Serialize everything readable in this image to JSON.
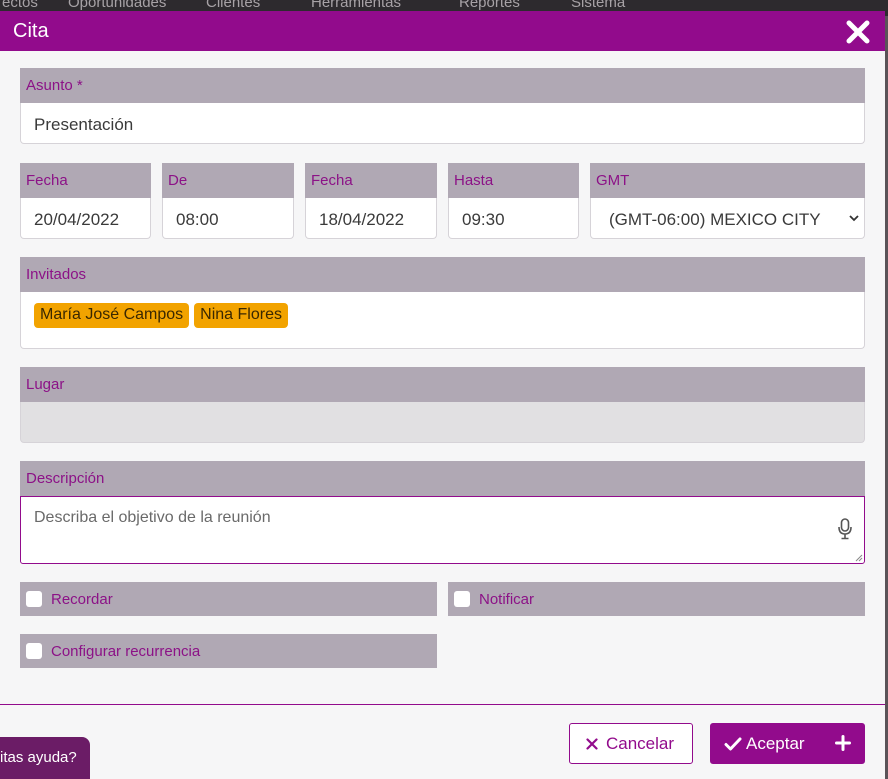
{
  "background": {
    "nav_items": [
      "ectos",
      "Oportunidades",
      "Clientes",
      "Herramientas",
      "Reportes",
      "Sistema"
    ],
    "help_label": "itas ayuda?"
  },
  "modal": {
    "title": "Cita",
    "subject": {
      "label": "Asunto *",
      "value": "Presentación"
    },
    "start_date": {
      "label": "Fecha",
      "value": "20/04/2022"
    },
    "start_time": {
      "label": "De",
      "value": "08:00"
    },
    "end_date": {
      "label": "Fecha",
      "value": "18/04/2022"
    },
    "end_time": {
      "label": "Hasta",
      "value": "09:30"
    },
    "timezone": {
      "label": "GMT",
      "value": "(GMT-06:00) MEXICO CITY"
    },
    "guests": {
      "label": "Invitados",
      "tags": [
        "María José Campos",
        "Nina Flores"
      ]
    },
    "place": {
      "label": "Lugar",
      "value": ""
    },
    "description": {
      "label": "Descripción",
      "placeholder": "Describa el objetivo de la reunión"
    },
    "options": {
      "remind": "Recordar",
      "notify": "Notificar",
      "recurrence": "Configurar recurrencia"
    },
    "buttons": {
      "cancel": "Cancelar",
      "accept": "Aceptar"
    }
  },
  "colors": {
    "brand": "#920b8c",
    "field_header": "#b0a8b4",
    "tag": "#f2a300"
  },
  "icons": [
    "close-icon",
    "chevron-down-icon",
    "microphone-icon",
    "resize-handle-icon",
    "x-icon",
    "check-icon",
    "plus-icon"
  ]
}
